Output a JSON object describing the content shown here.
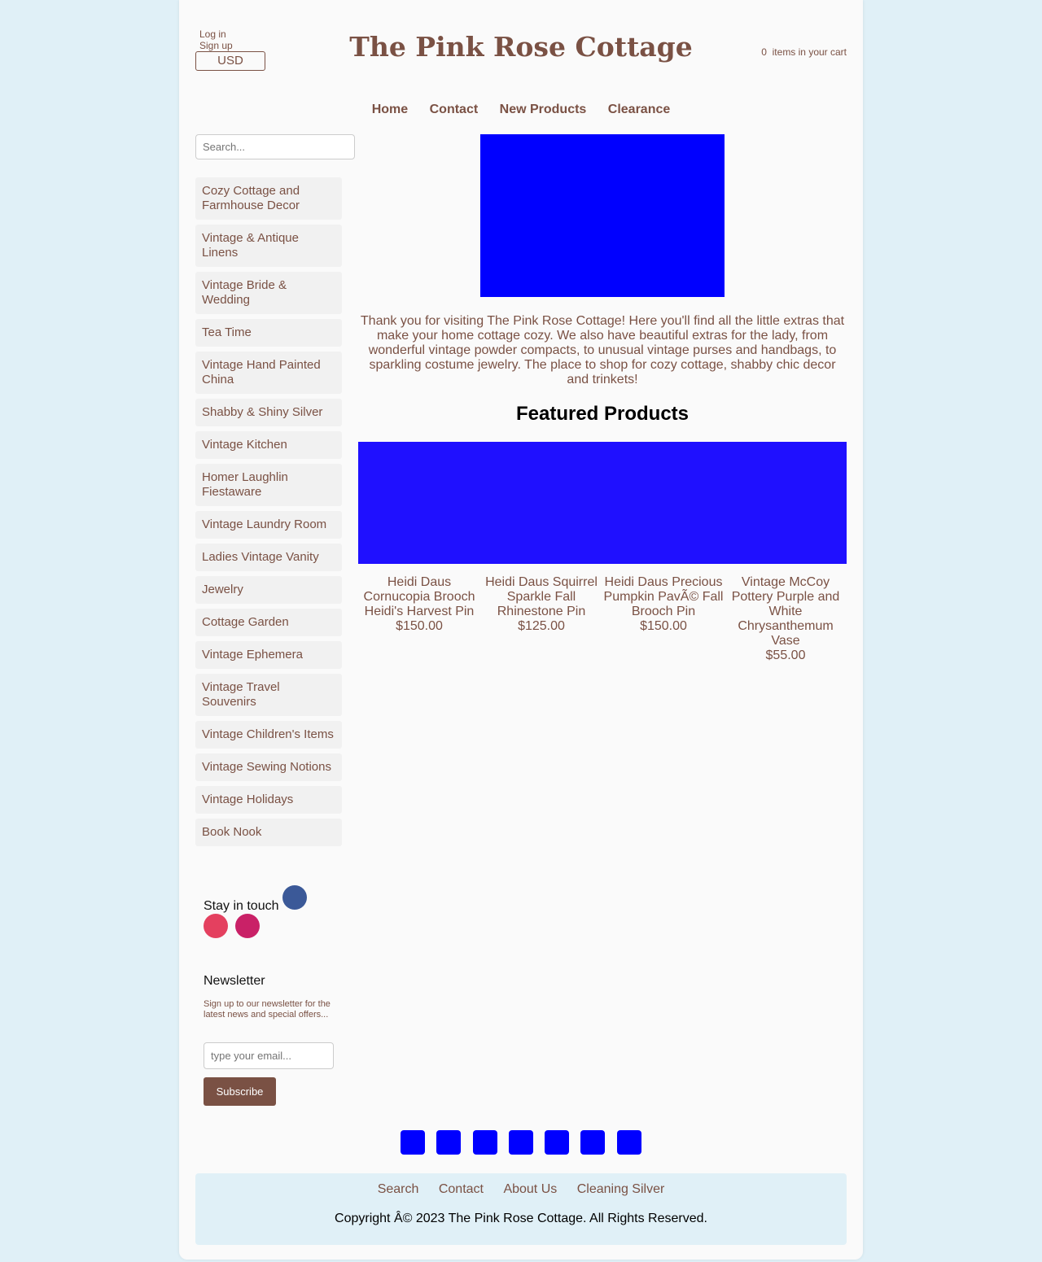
{
  "header": {
    "login": "Log in",
    "signup": "Sign up",
    "currency": "USD",
    "site_title": "The Pink Rose Cottage",
    "cart_count": "0",
    "cart_label": "items in your cart"
  },
  "nav": [
    "Home",
    "Contact",
    "New Products",
    "Clearance"
  ],
  "sidebar": {
    "search_placeholder": "Search...",
    "categories": [
      "Cozy Cottage and Farmhouse Decor",
      "Vintage & Antique Linens",
      "Vintage Bride & Wedding",
      "Tea Time",
      "Vintage Hand Painted China",
      "Shabby & Shiny Silver",
      "Vintage Kitchen",
      "Homer Laughlin Fiestaware",
      "Vintage Laundry Room",
      "Ladies Vintage Vanity",
      "Jewelry",
      "Cottage Garden",
      "Vintage Ephemera",
      "Vintage Travel Souvenirs",
      "Vintage Children's Items",
      "Vintage Sewing Notions",
      "Vintage Holidays",
      "Book Nook"
    ],
    "stay_in_touch": "Stay in touch",
    "social_colors": [
      "#3b5998",
      "#e4405f",
      "#c92167"
    ],
    "newsletter_title": "Newsletter",
    "newsletter_text": "Sign up to our newsletter for the latest news and special offers...",
    "email_placeholder": "type your email...",
    "subscribe_label": "Subscribe"
  },
  "main": {
    "welcome": "Thank you for visiting The Pink Rose Cottage! Here you'll find all the little extras that make your home cottage cozy. We also have beautiful extras for the lady, from wonderful vintage powder compacts, to unusual vintage purses and handbags, to sparkling costume jewelry. The place to shop for cozy cottage, shabby chic decor and trinkets!",
    "featured_heading": "Featured Products",
    "products": [
      {
        "name": "Heidi Daus Cornucopia Brooch Heidi's Harvest Pin",
        "price": "$150.00"
      },
      {
        "name": "Heidi Daus Squirrel Sparkle Fall Rhinestone Pin",
        "price": "$125.00"
      },
      {
        "name": "Heidi Daus Precious Pumpkin PavÃ© Fall Brooch Pin",
        "price": "$150.00"
      },
      {
        "name": "Vintage McCoy Pottery Purple and White Chrysanthemum Vase",
        "price": "$55.00"
      }
    ]
  },
  "footer": {
    "links": [
      "Search",
      "Contact",
      "About Us",
      "Cleaning Silver"
    ],
    "copyright": "Copyright Â© 2023 The Pink Rose Cottage. All Rights Reserved."
  }
}
